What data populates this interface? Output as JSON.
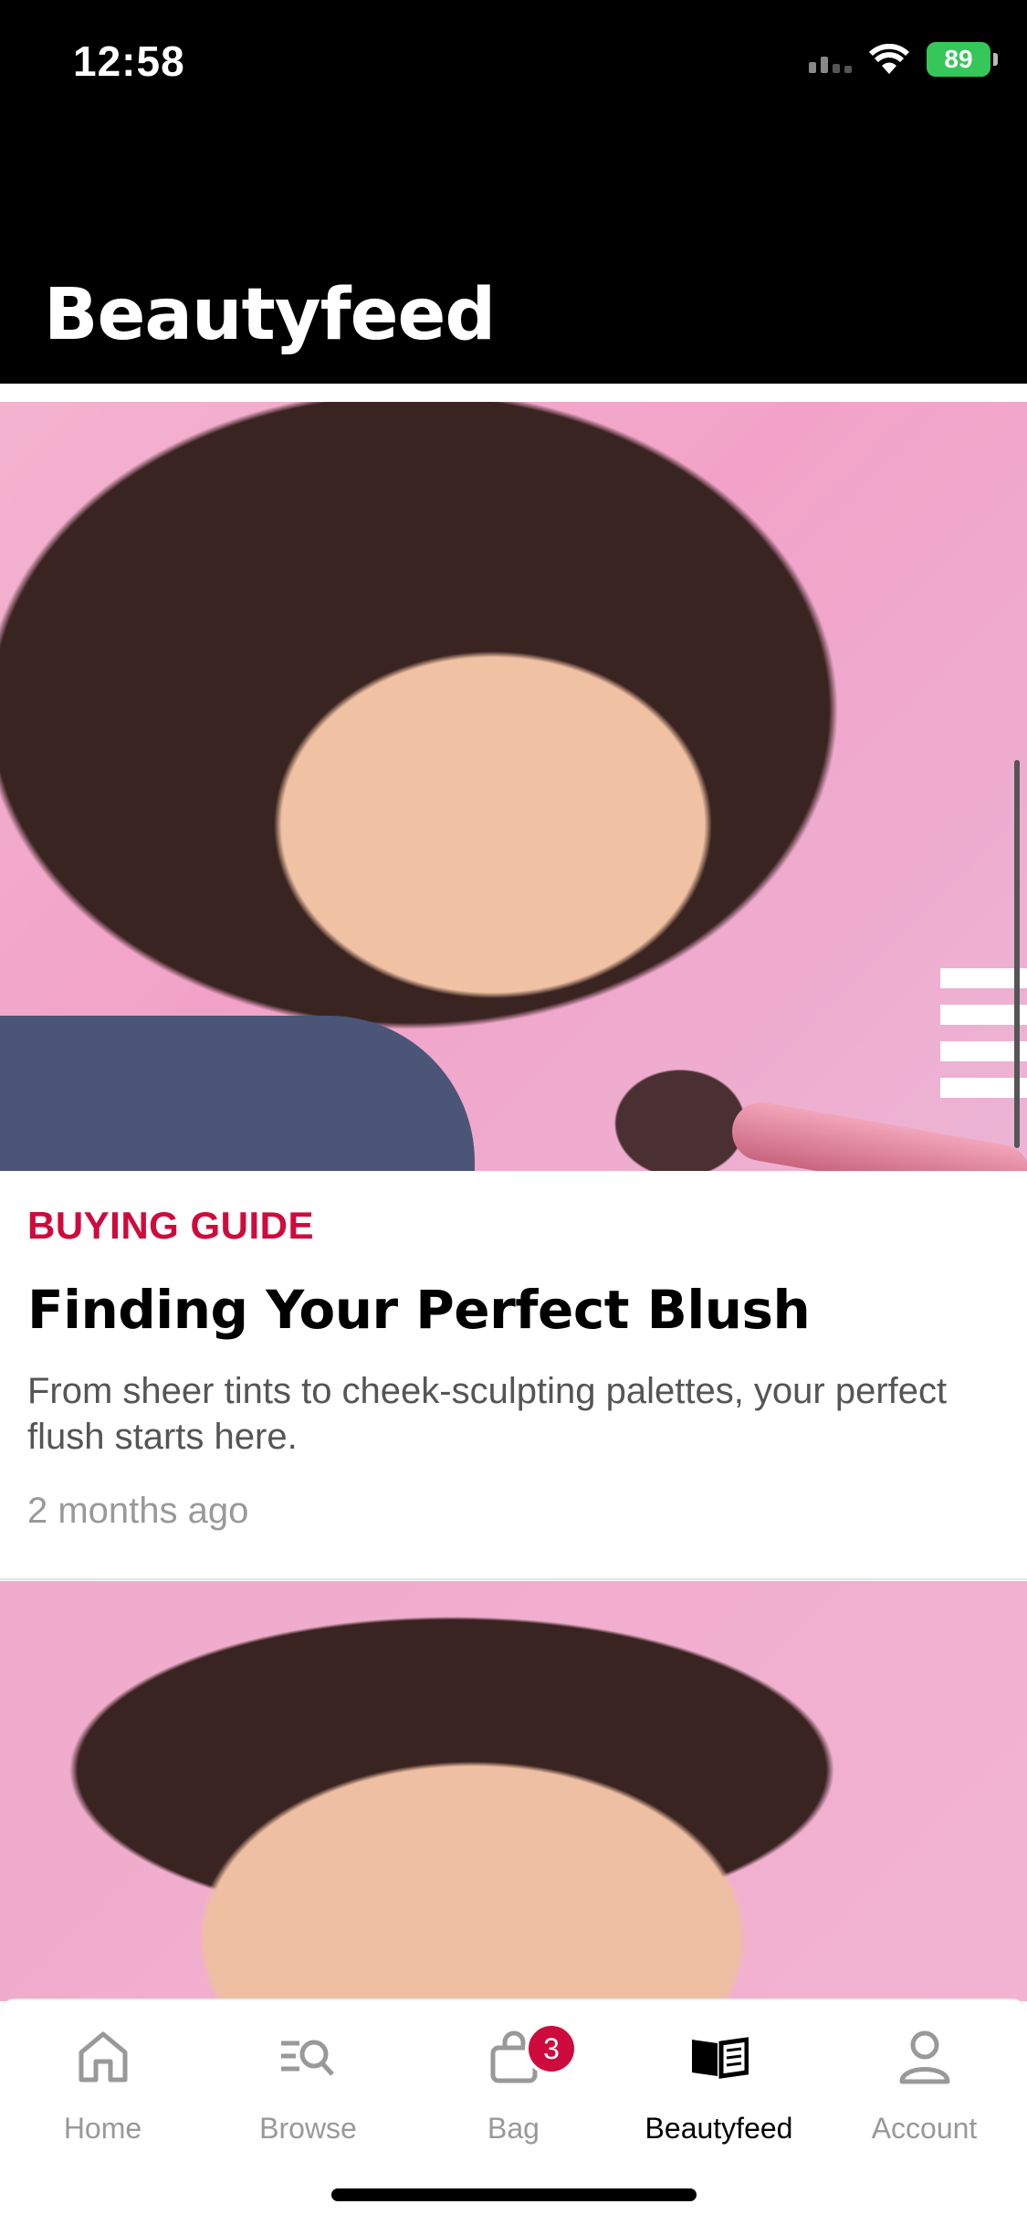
{
  "status_bar": {
    "time": "12:58",
    "battery": "89"
  },
  "header": {
    "title": "Beautyfeed"
  },
  "articles": [
    {
      "category": "BUYING GUIDE",
      "title": "Finding Your Perfect Blush",
      "description": "From sheer tints to cheek-sculpting palettes, your perfect flush starts here.",
      "date": "2 months ago"
    }
  ],
  "tabbar": {
    "items": [
      {
        "label": "Home",
        "icon": "home-icon"
      },
      {
        "label": "Browse",
        "icon": "browse-icon"
      },
      {
        "label": "Bag",
        "icon": "bag-icon",
        "badge": "3"
      },
      {
        "label": "Beautyfeed",
        "icon": "beautyfeed-icon"
      },
      {
        "label": "Account",
        "icon": "account-icon"
      }
    ],
    "active": "Beautyfeed"
  },
  "colors": {
    "accent": "#cf0a3c",
    "header_bg": "#000000",
    "battery": "#35c759"
  }
}
